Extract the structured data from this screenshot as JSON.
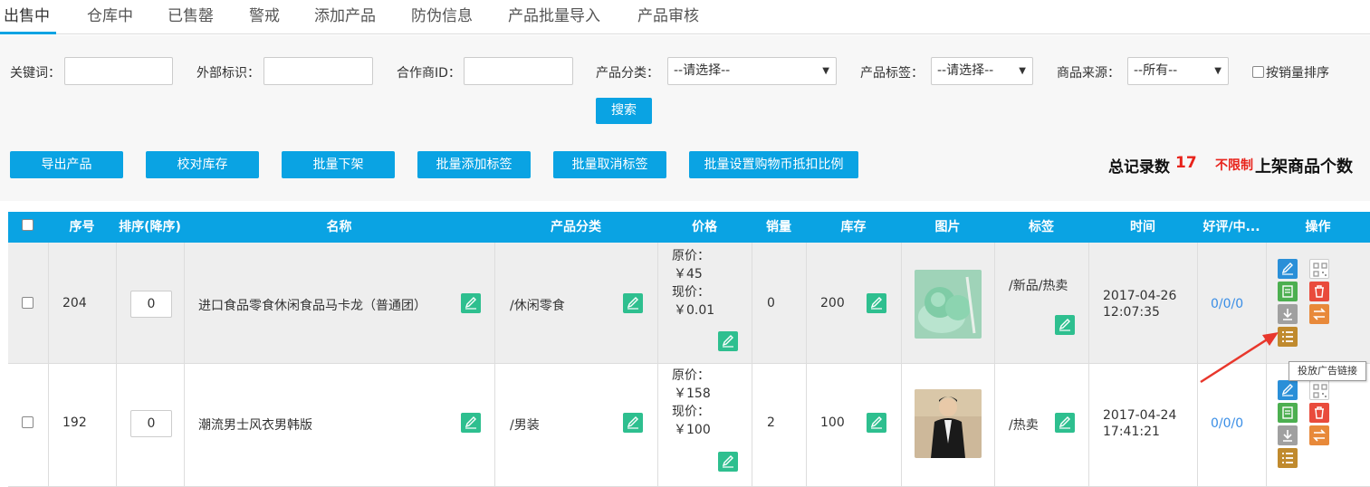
{
  "tabs": [
    {
      "label": "出售中",
      "active": true
    },
    {
      "label": "仓库中"
    },
    {
      "label": "已售罄"
    },
    {
      "label": "警戒"
    },
    {
      "label": "添加产品"
    },
    {
      "label": "防伪信息"
    },
    {
      "label": "产品批量导入"
    },
    {
      "label": "产品审核"
    }
  ],
  "filters": {
    "keyword_label": "关键词：",
    "keyword_value": "",
    "external_label": "外部标识：",
    "external_value": "",
    "partner_label": "合作商ID：",
    "partner_value": "",
    "category_label": "产品分类：",
    "category_value": "--请选择--",
    "tag_label": "产品标签：",
    "tag_value": "--请选择--",
    "source_label": "商品来源：",
    "source_value": "--所有--",
    "sort_by_sales_label": "按销量排序",
    "search_button": "搜索"
  },
  "actions": [
    "导出产品",
    "校对库存",
    "批量下架",
    "批量添加标签",
    "批量取消标签",
    "批量设置购物币抵扣比例"
  ],
  "summary": {
    "total_label": "总记录数",
    "total_value": "17",
    "limit_value": "不限制",
    "limit_label": "上架商品个数"
  },
  "table": {
    "headers": [
      "序号",
      "排序(降序)",
      "名称",
      "产品分类",
      "价格",
      "销量",
      "库存",
      "图片",
      "标签",
      "时间",
      "好评/中...",
      "操作"
    ],
    "rows": [
      {
        "id": "204",
        "sort": "0",
        "name": "进口食品零食休闲食品马卡龙（普通团）",
        "category": "/休闲零食",
        "price_original_label": "原价：",
        "price_original": "￥45",
        "price_now_label": "现价：",
        "price_now": "￥0.01",
        "sales": "0",
        "stock": "200",
        "tags": "/新品/热卖",
        "date": "2017-04-26",
        "time": "12:07:35",
        "reviews": "0/0/0"
      },
      {
        "id": "192",
        "sort": "0",
        "name": "潮流男士风衣男韩版",
        "category": "/男装",
        "price_original_label": "原价：",
        "price_original": "￥158",
        "price_now_label": "现价：",
        "price_now": "￥100",
        "sales": "2",
        "stock": "100",
        "tags": "/热卖",
        "date": "2017-04-24",
        "time": "17:41:21",
        "reviews": "0/0/0"
      }
    ]
  },
  "tooltip": "投放广告链接",
  "colors": {
    "accent": "#0aa3e3",
    "edit_green": "#2ebf8f",
    "delete_red": "#e94b3c",
    "orange": "#e8893a",
    "arrow_red": "#e8372c"
  }
}
